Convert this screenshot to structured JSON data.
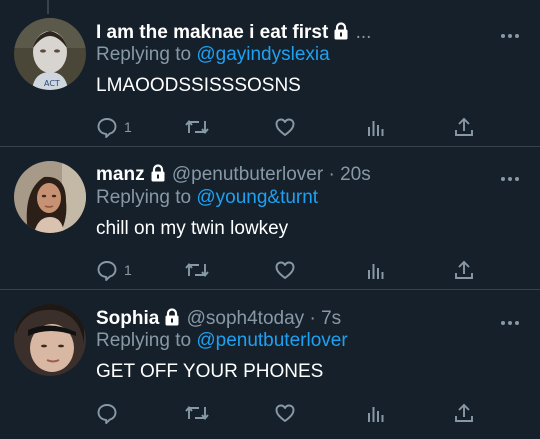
{
  "colors": {
    "background": "#15202b",
    "text": "#ffffff",
    "muted": "#8899a6",
    "link": "#1da1f2",
    "divider": "#38444d"
  },
  "tweets": [
    {
      "display_name": "I am the maknae i eat first",
      "protected_icon": "lock-icon",
      "handle": "",
      "separator": "",
      "time": "",
      "truncation": "...",
      "reply_prefix": "Replying to",
      "reply_to": "@gayindyslexia",
      "text": "LMAOODSSISSSOSNS",
      "reply_count": "1",
      "retweet_count": "",
      "like_count": "",
      "icons": [
        "reply-icon",
        "retweet-icon",
        "like-icon",
        "analytics-icon",
        "share-icon"
      ]
    },
    {
      "display_name": "manz",
      "protected_icon": "lock-icon",
      "handle": "@penutbuterlover",
      "separator": "·",
      "time": "20s",
      "truncation": "",
      "reply_prefix": "Replying to",
      "reply_to": "@young&turnt",
      "text": "chill on my twin lowkey",
      "reply_count": "1",
      "retweet_count": "",
      "like_count": "",
      "icons": [
        "reply-icon",
        "retweet-icon",
        "like-icon",
        "analytics-icon",
        "share-icon"
      ]
    },
    {
      "display_name": "Sophia",
      "protected_icon": "lock-icon",
      "handle": "@soph4today",
      "separator": "·",
      "time": "7s",
      "truncation": "",
      "reply_prefix": "Replying to",
      "reply_to": "@penutbuterlover",
      "text": "GET OFF YOUR PHONES",
      "reply_count": "",
      "retweet_count": "",
      "like_count": "",
      "icons": [
        "reply-icon",
        "retweet-icon",
        "like-icon",
        "analytics-icon",
        "share-icon"
      ]
    }
  ]
}
